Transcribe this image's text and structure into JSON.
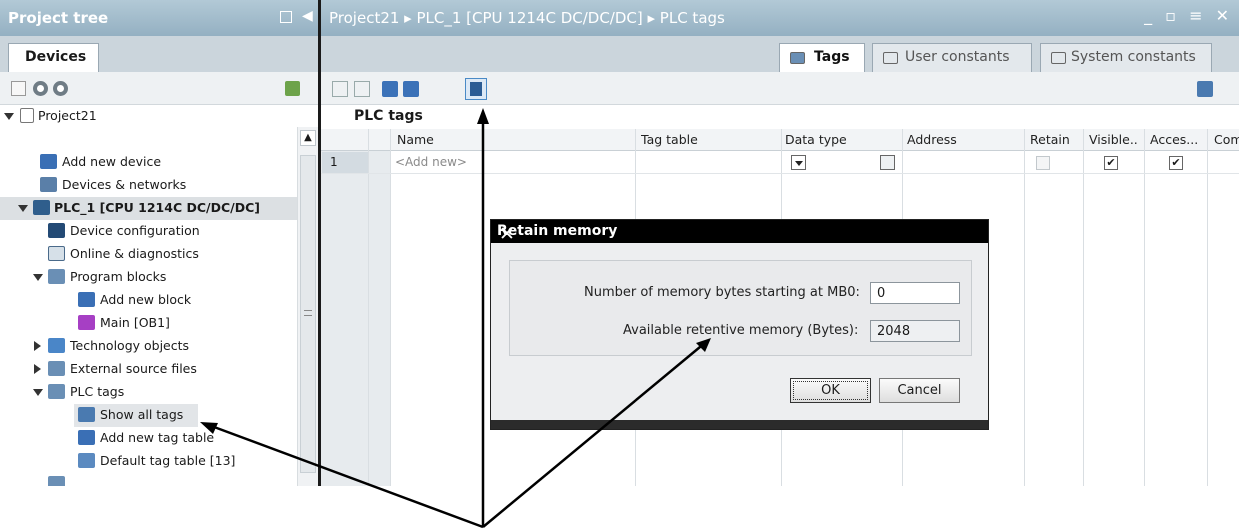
{
  "project_tree": {
    "title": "Project tree",
    "devices_tab": "Devices",
    "root": "Project21",
    "items": [
      {
        "label": "Add new device"
      },
      {
        "label": "Devices & networks"
      },
      {
        "label": "PLC_1 [CPU 1214C DC/DC/DC]"
      },
      {
        "label": "Device configuration"
      },
      {
        "label": "Online & diagnostics"
      },
      {
        "label": "Program blocks"
      },
      {
        "label": "Add new block"
      },
      {
        "label": "Main [OB1]"
      },
      {
        "label": "Technology objects"
      },
      {
        "label": "External source files"
      },
      {
        "label": "PLC tags"
      },
      {
        "label": "Show all tags"
      },
      {
        "label": "Add new tag table"
      },
      {
        "label": "Default tag table [13]"
      }
    ]
  },
  "editor": {
    "breadcrumb": "Project21 ▸ PLC_1 [CPU 1214C DC/DC/DC] ▸ PLC tags",
    "window_controls": "_ ▫ ≡ ✕",
    "tabs": {
      "tags": "Tags",
      "user_constants": "User constants",
      "system_constants": "System constants"
    },
    "section_title": "PLC tags",
    "columns": {
      "name": "Name",
      "tag_table": "Tag table",
      "data_type": "Data type",
      "address": "Address",
      "retain": "Retain",
      "visible": "Visible..",
      "access": "Acces...",
      "comment": "Com"
    },
    "row1": {
      "number": "1",
      "name": "<Add new>"
    }
  },
  "dialog": {
    "title": "Retain memory",
    "field1_label": "Number of memory bytes starting at MB0:",
    "field1_value": "0",
    "field2_label": "Available retentive memory (Bytes):",
    "field2_value": "2048",
    "ok": "OK",
    "cancel": "Cancel"
  }
}
